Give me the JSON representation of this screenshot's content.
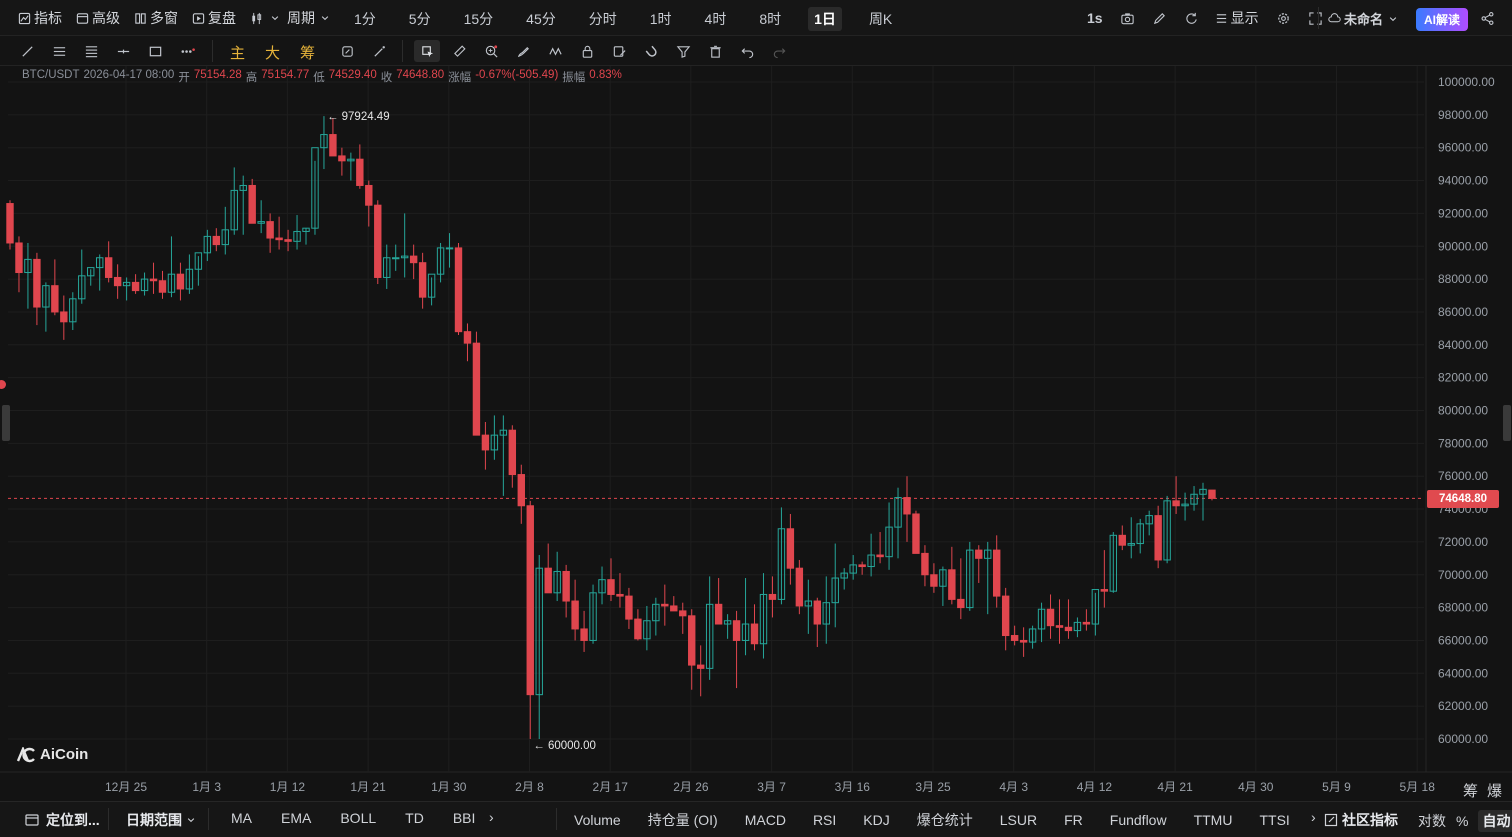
{
  "topbar": {
    "indicators_label": "指标",
    "advanced_label": "高级",
    "multiwindow_label": "多窗",
    "replay_label": "复盘",
    "period_label": "周期",
    "periods": [
      "1分",
      "5分",
      "15分",
      "45分",
      "分时",
      "1时",
      "4时",
      "8时",
      "1日",
      "周K"
    ],
    "active_period": "1日",
    "interval_label": "1s",
    "display_label": "显示",
    "layout_name": "未命名",
    "ai_label": "AI解读"
  },
  "toolbar2": {
    "main_label": "主",
    "big_label": "大",
    "chip_label": "筹"
  },
  "ohlc": {
    "symbol": "BTC/USDT",
    "datetime": "2026-04-17 08:00",
    "open_label": "开",
    "open": "75154.28",
    "high_label": "高",
    "high": "75154.77",
    "low_label": "低",
    "low": "74529.40",
    "close_label": "收",
    "close": "74648.80",
    "change_label": "涨幅",
    "change": "-0.67%(-505.49)",
    "amp_label": "振幅",
    "amp": "0.83%"
  },
  "brand": "AiCoin",
  "current_price": "74648.80",
  "chart_data": {
    "type": "candlestick",
    "y_ticks": [
      60000,
      62000,
      64000,
      66000,
      68000,
      70000,
      72000,
      74000,
      76000,
      78000,
      80000,
      82000,
      84000,
      86000,
      88000,
      90000,
      92000,
      94000,
      96000,
      98000,
      100000
    ],
    "y_tick_labels": [
      "60000.00",
      "62000.00",
      "64000.00",
      "66000.00",
      "68000.00",
      "70000.00",
      "72000.00",
      "74000.00",
      "76000.00",
      "78000.00",
      "80000.00",
      "82000.00",
      "84000.00",
      "86000.00",
      "88000.00",
      "90000.00",
      "92000.00",
      "94000.00",
      "96000.00",
      "98000.00",
      "100000.00"
    ],
    "x_tick_labels": [
      "12月 25",
      "1月 3",
      "1月 12",
      "1月 21",
      "1月 30",
      "2月 8",
      "2月 17",
      "2月 26",
      "3月 7",
      "3月 16",
      "3月 25",
      "4月 3",
      "4月 12",
      "4月 21",
      "4月 30",
      "5月 9",
      "5月 18"
    ],
    "ylim": [
      59000,
      101000
    ],
    "high_annotation": "97924.49",
    "low_annotation": "60000.00",
    "current_price": 74648.8,
    "candles": [
      [
        92600,
        92800,
        89800,
        90200
      ],
      [
        90200,
        90600,
        87200,
        88400
      ],
      [
        88400,
        90200,
        86200,
        89200
      ],
      [
        89200,
        89600,
        85200,
        86300
      ],
      [
        86300,
        87800,
        84800,
        87600
      ],
      [
        87600,
        89200,
        85800,
        86000
      ],
      [
        86000,
        87000,
        84300,
        85400
      ],
      [
        85400,
        87200,
        84900,
        86800
      ],
      [
        86800,
        89800,
        86500,
        88200
      ],
      [
        88200,
        88600,
        87600,
        88700
      ],
      [
        88700,
        89500,
        87300,
        89300
      ],
      [
        89300,
        90300,
        87800,
        88100
      ],
      [
        88100,
        88900,
        86800,
        87600
      ],
      [
        87600,
        88100,
        86700,
        87800
      ],
      [
        87800,
        88300,
        87100,
        87300
      ],
      [
        87300,
        88400,
        87000,
        88000
      ],
      [
        88000,
        89000,
        87100,
        87900
      ],
      [
        87900,
        88500,
        86800,
        87200
      ],
      [
        87200,
        90600,
        86900,
        88300
      ],
      [
        88300,
        89000,
        86700,
        87400
      ],
      [
        87400,
        89500,
        87100,
        88600
      ],
      [
        88600,
        89400,
        87600,
        89600
      ],
      [
        89600,
        91000,
        89100,
        90600
      ],
      [
        90600,
        91100,
        89700,
        90100
      ],
      [
        90100,
        92400,
        89500,
        91000
      ],
      [
        91000,
        94800,
        90700,
        93400
      ],
      [
        93400,
        94300,
        90700,
        93700
      ],
      [
        93700,
        94100,
        91500,
        91400
      ],
      [
        91400,
        92800,
        90800,
        91500
      ],
      [
        91500,
        92000,
        89600,
        90500
      ],
      [
        90500,
        91800,
        89800,
        90400
      ],
      [
        90400,
        91000,
        89700,
        90300
      ],
      [
        90300,
        91900,
        89800,
        90900
      ],
      [
        90900,
        91100,
        90100,
        91100
      ],
      [
        91100,
        95200,
        90700,
        96000
      ],
      [
        96000,
        97924,
        94700,
        96800
      ],
      [
        96800,
        97800,
        95500,
        95500
      ],
      [
        95500,
        96000,
        94300,
        95200
      ],
      [
        95200,
        95700,
        94000,
        95300
      ],
      [
        95300,
        96200,
        93500,
        93700
      ],
      [
        93700,
        94000,
        91200,
        92500
      ],
      [
        92500,
        92800,
        87700,
        88100
      ],
      [
        88100,
        90100,
        87400,
        89300
      ],
      [
        89300,
        90100,
        88500,
        89300
      ],
      [
        89300,
        92000,
        88100,
        89400
      ],
      [
        89400,
        90100,
        88000,
        89000
      ],
      [
        89000,
        89600,
        86200,
        86900
      ],
      [
        86900,
        88100,
        86400,
        88300
      ],
      [
        88300,
        90200,
        87800,
        89900
      ],
      [
        89900,
        90800,
        88700,
        89900
      ],
      [
        89900,
        90200,
        84600,
        84800
      ],
      [
        84800,
        85300,
        83000,
        84100
      ],
      [
        84100,
        84800,
        78600,
        78500
      ],
      [
        78500,
        79300,
        76400,
        77600
      ],
      [
        77600,
        79700,
        77000,
        78500
      ],
      [
        78500,
        79700,
        74800,
        78800
      ],
      [
        78800,
        79100,
        75300,
        76100
      ],
      [
        76100,
        76700,
        73100,
        74200
      ],
      [
        74200,
        74500,
        60000,
        62700
      ],
      [
        62700,
        71200,
        60000,
        70400
      ],
      [
        70400,
        71900,
        69000,
        68900
      ],
      [
        68900,
        71400,
        68400,
        70200
      ],
      [
        70200,
        70600,
        67400,
        68400
      ],
      [
        68400,
        69700,
        66000,
        66700
      ],
      [
        66700,
        67800,
        65300,
        66000
      ],
      [
        66000,
        69400,
        65800,
        68900
      ],
      [
        68900,
        70500,
        68200,
        69700
      ],
      [
        69700,
        71000,
        68400,
        68800
      ],
      [
        68800,
        70100,
        68000,
        68700
      ],
      [
        68700,
        69200,
        66700,
        67300
      ],
      [
        67300,
        67900,
        66000,
        66100
      ],
      [
        66100,
        68100,
        65400,
        67200
      ],
      [
        67200,
        68600,
        66300,
        68200
      ],
      [
        68200,
        69400,
        66900,
        68100
      ],
      [
        68100,
        68700,
        67800,
        67800
      ],
      [
        67800,
        68300,
        66400,
        67500
      ],
      [
        67500,
        67900,
        63000,
        64500
      ],
      [
        64500,
        65700,
        62600,
        64300
      ],
      [
        64300,
        69900,
        63600,
        68200
      ],
      [
        68200,
        69800,
        67400,
        67000
      ],
      [
        67000,
        67600,
        66100,
        67200
      ],
      [
        67200,
        67800,
        63100,
        66000
      ],
      [
        66000,
        69800,
        65100,
        67000
      ],
      [
        67000,
        68200,
        65400,
        65800
      ],
      [
        65800,
        70100,
        64900,
        68800
      ],
      [
        68800,
        69900,
        67400,
        68500
      ],
      [
        68500,
        74100,
        68200,
        72800
      ],
      [
        72800,
        73700,
        69400,
        70400
      ],
      [
        70400,
        70900,
        67600,
        68100
      ],
      [
        68100,
        69700,
        66400,
        68400
      ],
      [
        68400,
        68600,
        65600,
        67000
      ],
      [
        67000,
        69900,
        65800,
        68300
      ],
      [
        68300,
        71900,
        66800,
        69800
      ],
      [
        69800,
        70400,
        69100,
        70100
      ],
      [
        70100,
        71200,
        69700,
        70600
      ],
      [
        70600,
        70800,
        70000,
        70500
      ],
      [
        70500,
        72500,
        69900,
        71200
      ],
      [
        71200,
        72600,
        70700,
        71100
      ],
      [
        71100,
        74400,
        70300,
        72900
      ],
      [
        72900,
        75300,
        71000,
        74700
      ],
      [
        74700,
        76000,
        72000,
        73700
      ],
      [
        73700,
        73900,
        71600,
        71300
      ],
      [
        71300,
        71800,
        69300,
        70000
      ],
      [
        70000,
        70700,
        68900,
        69300
      ],
      [
        69300,
        70500,
        68100,
        70300
      ],
      [
        70300,
        71700,
        68200,
        68500
      ],
      [
        68500,
        71000,
        67300,
        68000
      ],
      [
        68000,
        72000,
        67800,
        71500
      ],
      [
        71500,
        71800,
        69500,
        71000
      ],
      [
        71000,
        72000,
        67600,
        71500
      ],
      [
        71500,
        72400,
        68000,
        68700
      ],
      [
        68700,
        69200,
        65400,
        66300
      ],
      [
        66300,
        66900,
        65700,
        66000
      ],
      [
        66000,
        66800,
        65000,
        65900
      ],
      [
        65900,
        66900,
        65500,
        66700
      ],
      [
        66700,
        68300,
        65900,
        67900
      ],
      [
        67900,
        68800,
        66100,
        66900
      ],
      [
        66900,
        68500,
        65800,
        66800
      ],
      [
        66800,
        68500,
        66100,
        66600
      ],
      [
        66600,
        67400,
        66200,
        67100
      ],
      [
        67100,
        67900,
        66600,
        67000
      ],
      [
        67000,
        68900,
        66300,
        69100
      ],
      [
        69100,
        71500,
        68000,
        69000
      ],
      [
        69000,
        72600,
        68900,
        72400
      ],
      [
        72400,
        73000,
        71500,
        71800
      ],
      [
        71800,
        73500,
        71000,
        71900
      ],
      [
        71900,
        73400,
        71300,
        73100
      ],
      [
        73100,
        73900,
        72400,
        73600
      ],
      [
        73600,
        74200,
        70400,
        70900
      ],
      [
        70900,
        74800,
        70700,
        74500
      ],
      [
        74500,
        76000,
        73700,
        74200
      ],
      [
        74200,
        75000,
        73300,
        74300
      ],
      [
        74300,
        75400,
        73900,
        74900
      ],
      [
        74900,
        75600,
        73300,
        75200
      ],
      [
        75154,
        75154,
        74529,
        74649
      ]
    ]
  },
  "bottombar": {
    "locate_label": "定位到...",
    "date_range_label": "日期范围",
    "left_indicators": [
      "MA",
      "EMA",
      "BOLL",
      "TD",
      "BBI"
    ],
    "right_indicators": [
      "Volume",
      "持仓量 (OI)",
      "MACD",
      "RSI",
      "KDJ",
      "爆仓统计",
      "LSUR",
      "FR",
      "Fundflow",
      "TTMU",
      "TTSI"
    ],
    "community_label": "社区指标",
    "log_label": "对数",
    "percent_label": "%",
    "auto_label": "自动"
  },
  "side_labels": {
    "chip": "筹",
    "liq": "爆"
  },
  "colors": {
    "up": "#26a69a",
    "down": "#e0464e",
    "bg": "#131313",
    "grid": "#1f1f1f"
  }
}
